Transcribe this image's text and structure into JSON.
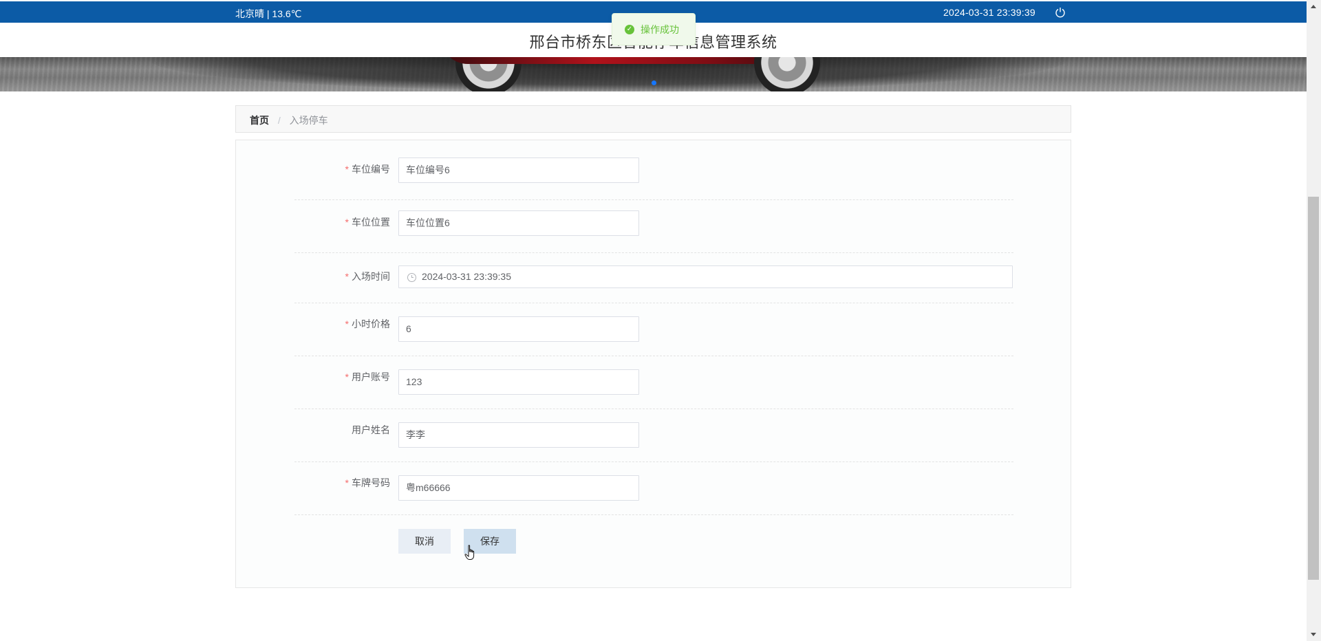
{
  "topbar": {
    "weather": "北京晴 | 13.6℃",
    "datetime": "2024-03-31   23:39:39",
    "power_icon": "power-icon",
    "color": "#0c5ba6"
  },
  "header": {
    "title": "邢台市桥东区智能停车信息管理系统"
  },
  "toast": {
    "message": "操作成功",
    "icon": "check-circle-icon",
    "color": "#67c23a"
  },
  "breadcrumb": {
    "home": "首页",
    "separator": "/",
    "current": "入场停车"
  },
  "form": {
    "fields": [
      {
        "label": "车位编号",
        "required": true,
        "value": "车位编号6"
      },
      {
        "label": "车位位置",
        "required": true,
        "value": "车位位置6"
      },
      {
        "label": "入场时间",
        "required": true,
        "value": "2024-03-31 23:39:35",
        "icon": "clock-icon"
      },
      {
        "label": "小时价格",
        "required": true,
        "value": "6"
      },
      {
        "label": "用户账号",
        "required": true,
        "value": "123"
      },
      {
        "label": "用户姓名",
        "required": false,
        "value": "李李"
      },
      {
        "label": "车牌号码",
        "required": true,
        "value": "粤m66666"
      }
    ],
    "required_mark": "*",
    "cancel_label": "取消",
    "save_label": "保存"
  }
}
